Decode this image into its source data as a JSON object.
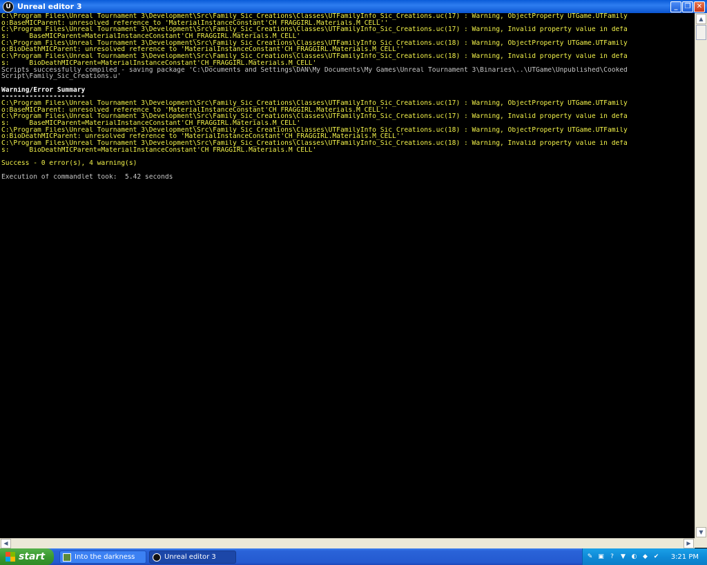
{
  "window": {
    "title": "Unreal editor 3",
    "minimize": "_",
    "restore": "❐",
    "close": "✕"
  },
  "console": {
    "lines": [
      {
        "text": "C:\\Program Files\\Unreal Tournament 3\\Development\\Src\\Family_Sic_Creations\\Classes\\UTFamilyInfo_Sic_Creations.uc(17) : Warning, ObjectProperty UTGame.UTFamily",
        "color": "y"
      },
      {
        "text": "o:BaseMICParent: unresolved reference to 'MaterialInstanceConstant'CH_FRAGGIRL.Materials.M_CELL''",
        "color": "y"
      },
      {
        "text": "C:\\Program Files\\Unreal Tournament 3\\Development\\Src\\Family_Sic_Creations\\Classes\\UTFamilyInfo_Sic_Creations.uc(17) : Warning, Invalid property value in defa",
        "color": "y"
      },
      {
        "text": "s:     BaseMICParent=MaterialInstanceConstant'CH_FRAGGIRL.Materials.M_CELL'",
        "color": "y"
      },
      {
        "text": "C:\\Program Files\\Unreal Tournament 3\\Development\\Src\\Family_Sic_Creations\\Classes\\UTFamilyInfo_Sic_Creations.uc(18) : Warning, ObjectProperty UTGame.UTFamily",
        "color": "y"
      },
      {
        "text": "o:BioDeathMICParent: unresolved reference to 'MaterialInstanceConstant'CH_FRAGGIRL.Materials.M_CELL''",
        "color": "y"
      },
      {
        "text": "C:\\Program Files\\Unreal Tournament 3\\Development\\Src\\Family_Sic_Creations\\Classes\\UTFamilyInfo_Sic_Creations.uc(18) : Warning, Invalid property value in defa",
        "color": "y"
      },
      {
        "text": "s:     BioDeathMICParent=MaterialInstanceConstant'CH_FRAGGIRL.Materials.M_CELL'",
        "color": "y"
      },
      {
        "text": "Scripts successfully compiled - saving package 'C:\\Documents and Settings\\DAN\\My Documents\\My Games\\Unreal Tournament 3\\Binaries\\..\\UTGame\\Unpublished\\Cooked",
        "color": "g"
      },
      {
        "text": "Script\\Family_Sic_Creations.u'",
        "color": "g"
      },
      {
        "text": "",
        "color": "g"
      },
      {
        "text": "Warning/Error Summary",
        "color": "w"
      },
      {
        "text": "---------------------",
        "color": "w"
      },
      {
        "text": "C:\\Program Files\\Unreal Tournament 3\\Development\\Src\\Family_Sic_Creations\\Classes\\UTFamilyInfo_Sic_Creations.uc(17) : Warning, ObjectProperty UTGame.UTFamily",
        "color": "y"
      },
      {
        "text": "o:BaseMICParent: unresolved reference to 'MaterialInstanceConstant'CH_FRAGGIRL.Materials.M_CELL''",
        "color": "y"
      },
      {
        "text": "C:\\Program Files\\Unreal Tournament 3\\Development\\Src\\Family_Sic_Creations\\Classes\\UTFamilyInfo_Sic_Creations.uc(17) : Warning, Invalid property value in defa",
        "color": "y"
      },
      {
        "text": "s:     BaseMICParent=MaterialInstanceConstant'CH_FRAGGIRL.Materials.M_CELL'",
        "color": "y"
      },
      {
        "text": "C:\\Program Files\\Unreal Tournament 3\\Development\\Src\\Family_Sic_Creations\\Classes\\UTFamilyInfo_Sic_Creations.uc(18) : Warning, ObjectProperty UTGame.UTFamily",
        "color": "y"
      },
      {
        "text": "o:BioDeathMICParent: unresolved reference to 'MaterialInstanceConstant'CH_FRAGGIRL.Materials.M_CELL''",
        "color": "y"
      },
      {
        "text": "C:\\Program Files\\Unreal Tournament 3\\Development\\Src\\Family_Sic_Creations\\Classes\\UTFamilyInfo_Sic_Creations.uc(18) : Warning, Invalid property value in defa",
        "color": "y"
      },
      {
        "text": "s:     BioDeathMICParent=MaterialInstanceConstant'CH_FRAGGIRL.Materials.M_CELL'",
        "color": "y"
      },
      {
        "text": "",
        "color": "g"
      },
      {
        "text": "Success - 0 error(s), 4 warning(s)",
        "color": "y"
      },
      {
        "text": "",
        "color": "g"
      },
      {
        "text": "Execution of commandlet took:  5.42 seconds",
        "color": "g"
      }
    ]
  },
  "taskbar": {
    "start_label": "start",
    "tasks": [
      {
        "label": "Into the darkness"
      },
      {
        "label": "Unreal editor 3"
      }
    ],
    "clock": "3:21 PM"
  },
  "colors": {
    "console_yellow": "#f3f34a",
    "console_gray": "#c8c8c8",
    "console_white": "#ffffff",
    "titlebar_blue": "#0a5bd8",
    "taskbar_blue": "#245ad0",
    "start_green": "#3a9a30"
  }
}
